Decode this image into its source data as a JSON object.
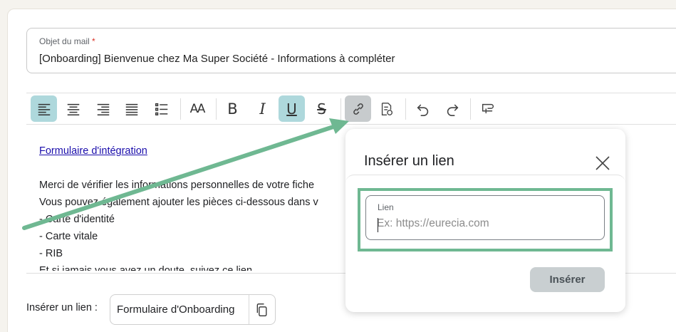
{
  "subject": {
    "label": "Objet du mail",
    "required_mark": "*",
    "value": "[Onboarding] Bienvenue chez Ma Super Société - Informations à compléter"
  },
  "toolbar": {
    "icons": [
      "align-left-icon",
      "align-center-icon",
      "align-right-icon",
      "align-justify-icon",
      "list-icon",
      "font-size-icon",
      "bold-icon",
      "italic-icon",
      "underline-icon",
      "strikethrough-icon",
      "link-icon",
      "insert-variable-icon",
      "undo-icon",
      "redo-icon",
      "clear-format-icon"
    ],
    "active": [
      "align-left-icon",
      "underline-icon"
    ],
    "highlighted": "link-icon",
    "font_size_glyph": "AA",
    "bold_glyph": "B",
    "italic_glyph": "I",
    "underline_glyph": "U",
    "strike_glyph": "S"
  },
  "content": {
    "link_text": "Formulaire d'intégration",
    "lines": [
      "Merci de vérifier les informations personnelles de votre fiche",
      "Vous pouvez également ajouter les pièces ci-dessous dans v",
      "- Carte d'identité",
      "- Carte vitale",
      "- RIB",
      "Et si jamais vous avez un doute, suivez ce lien."
    ]
  },
  "insert_row": {
    "label": "Insérer un lien :",
    "chip_text": "Formulaire d'Onboarding"
  },
  "modal": {
    "title": "Insérer un lien",
    "field_label": "Lien",
    "field_placeholder": "Ex: https://eurecia.com",
    "field_value": "",
    "submit_label": "Insérer"
  },
  "colors": {
    "accent_active": "#aed8dc",
    "annotation_green": "#6fb892",
    "button_disabled": "#c9cfd1"
  }
}
